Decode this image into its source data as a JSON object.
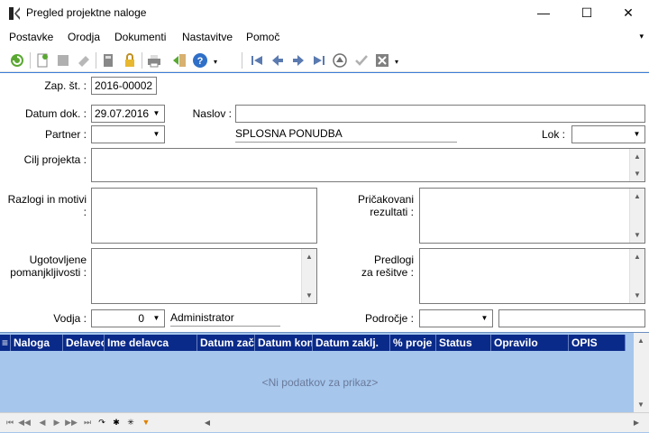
{
  "window": {
    "title": "Pregled projektne naloge",
    "minimize": "—",
    "maximize": "☐",
    "close": "✕"
  },
  "menu": {
    "items": [
      "Postavke",
      "Orodja",
      "Dokumenti",
      "Nastavitve",
      "Pomoč"
    ],
    "overflow": "▾"
  },
  "toolbar": {
    "icons": [
      "refresh-icon",
      "new-document-icon",
      "copy-icon",
      "eraser-icon",
      "calculator-icon",
      "lock-icon",
      "print-icon",
      "exit-icon",
      "help-icon",
      "first-record-icon",
      "previous-record-icon",
      "next-record-icon",
      "last-record-icon",
      "cancel-circle-icon",
      "confirm-check-icon",
      "close-box-icon"
    ]
  },
  "form": {
    "zap_st": {
      "label": "Zap. št. :",
      "value": "2016-00002"
    },
    "datum_dok": {
      "label": "Datum dok. :",
      "value": "29.07.2016"
    },
    "naslov": {
      "label": "Naslov :",
      "value": ""
    },
    "partner": {
      "label": "Partner :",
      "value": "",
      "name": "SPLOSNA PONUDBA"
    },
    "lok": {
      "label": "Lok :",
      "value": ""
    },
    "cilj": {
      "label": "Cilj projekta :"
    },
    "razlogi": {
      "label": "Razlogi in motivi :"
    },
    "pricakovani": {
      "label_line1": "Pričakovani",
      "label_line2": "rezultati :"
    },
    "ugotovljene": {
      "label_line1": "Ugotovljene",
      "label_line2": "pomanjkljivosti :"
    },
    "predlogi": {
      "label_line1": "Predlogi",
      "label_line2": "za rešitve :"
    },
    "vodja": {
      "label": "Vodja :",
      "value": "0",
      "name": "Administrator"
    },
    "podrocje": {
      "label": "Področje :",
      "value": "",
      "text": ""
    }
  },
  "grid": {
    "columns": [
      "Naloga",
      "Delavec",
      "Ime delavca",
      "Datum zač.",
      "Datum kon.",
      "Datum zaklj.",
      "% proje",
      "Status",
      "Opravilo",
      "OPIS"
    ],
    "empty_text": "<Ni podatkov za prikaz>"
  },
  "colors": {
    "grid_header": "#0a2a8a",
    "grid_background": "#a6c6ec",
    "accent_line": "#3b7dd8"
  }
}
